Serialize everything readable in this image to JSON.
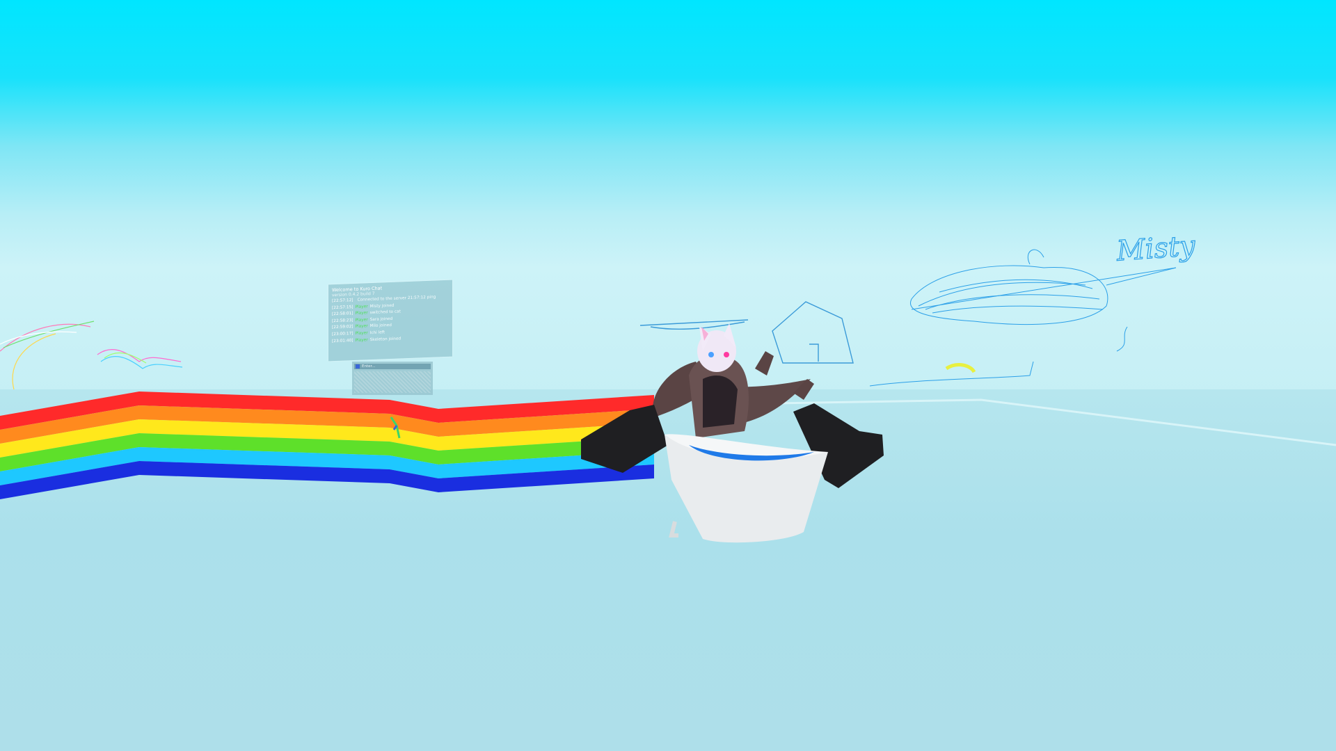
{
  "scene": {
    "sky_color": "#00e6ff",
    "floor_color": "#aee0ec",
    "rainbow_colors": [
      "#ff2a2a",
      "#ff8a1e",
      "#ffe81c",
      "#5ee02a",
      "#1ec8ff",
      "#1a2ee0"
    ]
  },
  "log_panel": {
    "title": "Welcome to Kuro Chat",
    "subtitle": "version 0.4.2 build 7",
    "lines": [
      {
        "ts": "[22:57:12]",
        "who": "",
        "text": "Connected to the server 21:57:12 ping"
      },
      {
        "ts": "[22:57:15]",
        "who": "Player",
        "text": "Misty joined"
      },
      {
        "ts": "[22:58:01]",
        "who": "Player",
        "text": "switched to cat"
      },
      {
        "ts": "[22:58:23]",
        "who": "Player",
        "text": "Sara joined"
      },
      {
        "ts": "[22:59:02]",
        "who": "Player",
        "text": "Milo joined"
      },
      {
        "ts": "[23:00:17]",
        "who": "Player",
        "text": "Ichi left"
      },
      {
        "ts": "[23:01:40]",
        "who": "Player",
        "text": "Skeleton joined"
      }
    ]
  },
  "input_panel": {
    "placeholder": "Enter..."
  },
  "drawings": {
    "signature": "Misty"
  }
}
